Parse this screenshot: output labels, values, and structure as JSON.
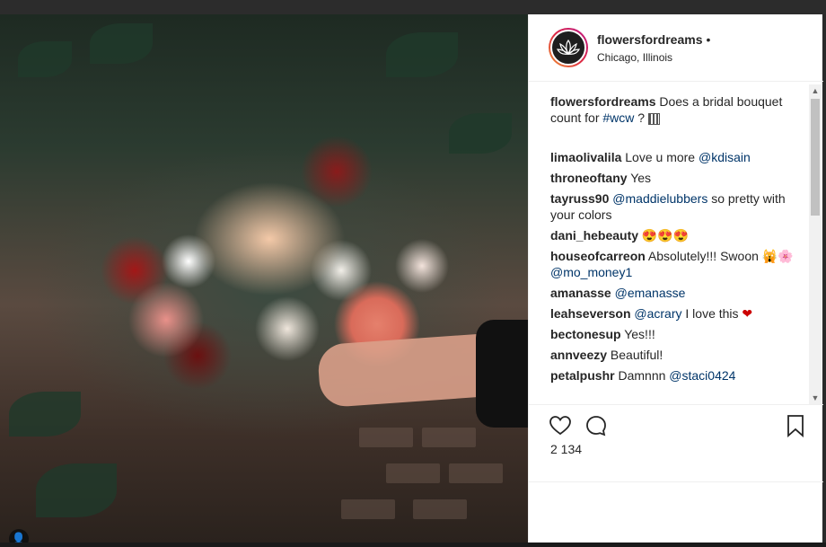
{
  "post": {
    "username": "flowersfordreams",
    "dot": "•",
    "location": "Chicago, Illinois",
    "avatar_icon": "lotus-logo-icon"
  },
  "caption": {
    "username": "flowersfordreams",
    "text": " Does a bridal bouquet count for ",
    "hashtag": "#wcw",
    "tail": " ? ",
    "tail_icon": "qr-emoji-icon"
  },
  "comments": [
    {
      "user": "limaolivalila",
      "text": " Love u more ",
      "mention": "@kdisain",
      "after": ""
    },
    {
      "user": "throneoftany",
      "text": " Yes",
      "mention": "",
      "after": ""
    },
    {
      "user": "tayruss90",
      "text": " ",
      "mention": "@maddielubbers",
      "after": " so pretty with your colors"
    },
    {
      "user": "dani_hebeauty",
      "text": " 😍😍😍",
      "mention": "",
      "after": ""
    },
    {
      "user": "houseofcarreon",
      "text": " Absolutely!!! Swoon 🙀🌸 ",
      "mention": "@mo_money1",
      "after": ""
    },
    {
      "user": "amanasse",
      "text": " ",
      "mention": "@emanasse",
      "after": ""
    },
    {
      "user": "leahseverson",
      "text": " ",
      "mention": "@acrary",
      "after": " I love this ❤"
    },
    {
      "user": "bectonesup",
      "text": " Yes!!!",
      "mention": "",
      "after": ""
    },
    {
      "user": "annveezy",
      "text": " Beautiful!",
      "mention": "",
      "after": ""
    },
    {
      "user": "petalpushr",
      "text": " Damnnn ",
      "mention": "@staci0424",
      "after": ""
    }
  ],
  "actions": {
    "like_icon": "heart-icon",
    "comment_icon": "comment-icon",
    "save_icon": "bookmark-icon"
  },
  "likes": "2 134",
  "scroll": {
    "up": "▲",
    "down": "▼"
  },
  "user_tag_icon": "user-tag-icon",
  "user_tag_glyph": "👤"
}
